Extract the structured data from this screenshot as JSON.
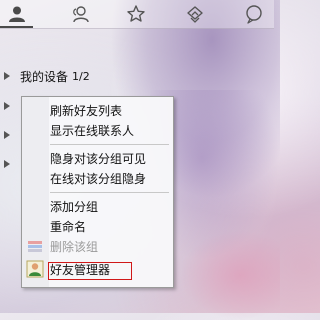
{
  "tabs": [
    {
      "icon": "contacts-icon"
    },
    {
      "icon": "groups-icon"
    },
    {
      "icon": "star-icon"
    },
    {
      "icon": "recent-icon"
    },
    {
      "icon": "chat-bubble-icon"
    }
  ],
  "groups": [
    {
      "label": "我的设备",
      "count": "1/2"
    }
  ],
  "context_menu": {
    "items": [
      {
        "label": "刷新好友列表",
        "enabled": true
      },
      {
        "label": "显示在线联系人",
        "enabled": true
      },
      {
        "label": "隐身对该分组可见",
        "enabled": true
      },
      {
        "label": "在线对该分组隐身",
        "enabled": true
      },
      {
        "label": "添加分组",
        "enabled": true
      },
      {
        "label": "重命名",
        "enabled": true
      },
      {
        "label": "删除该组",
        "enabled": false
      },
      {
        "label": "好友管理器",
        "enabled": true,
        "highlighted": true
      }
    ]
  },
  "colors": {
    "highlight_border": "#d01818",
    "menu_border": "#9a9a9a"
  }
}
